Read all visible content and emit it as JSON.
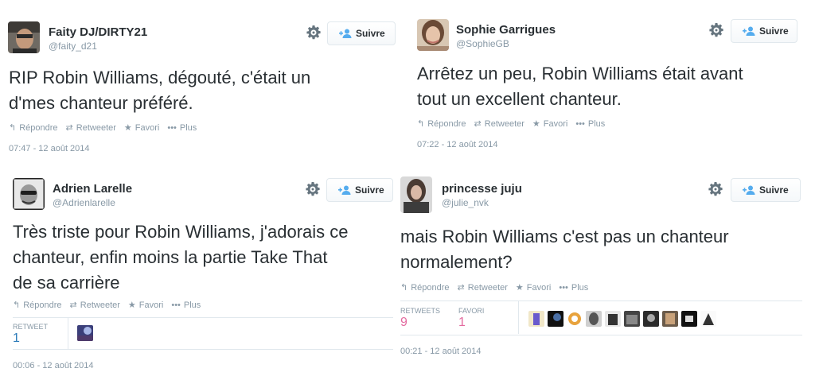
{
  "colors": {
    "text": "#292f33",
    "meta": "#8899a6",
    "follow_icon": "#55acee",
    "retweets_count": "#e36a9f",
    "favorites_count": "#e36a9f",
    "retweet_count_blue": "#2b7bb9",
    "divider": "#e1e8ed"
  },
  "tweets": [
    {
      "name": "Faity DJ/DIRTY21",
      "handle": "@faity_d21",
      "follow_label": "Suivre",
      "text_lines": [
        "RIP Robin Williams, dégouté, c'était un",
        "d'mes chanteur préféré."
      ],
      "actions": {
        "reply": "Répondre",
        "retweet": "Retweeter",
        "favorite": "Favori",
        "more": "Plus"
      },
      "timestamp": "07:47 - 12 août 2014"
    },
    {
      "name": "Sophie Garrigues",
      "handle": "@SophieGB",
      "follow_label": "Suivre",
      "text_lines": [
        "Arrêtez un peu, Robin Williams était avant",
        "tout un excellent chanteur."
      ],
      "actions": {
        "reply": "Répondre",
        "retweet": "Retweeter",
        "favorite": "Favori",
        "more": "Plus"
      },
      "timestamp": "07:22 - 12 août 2014"
    },
    {
      "name": "Adrien Larelle",
      "handle": "@Adrienlarelle",
      "follow_label": "Suivre",
      "text_lines": [
        "Très triste pour Robin Williams, j'adorais ce",
        "chanteur, enfin moins la partie Take That",
        "de sa carrière"
      ],
      "actions": {
        "reply": "Répondre",
        "retweet": "Retweeter",
        "favorite": "Favori",
        "more": "Plus"
      },
      "stats": {
        "retweet_label": "RETWEET",
        "retweet_value": "1"
      },
      "timestamp": "00:06 - 12 août 2014"
    },
    {
      "name": "princesse juju",
      "handle": "@julie_nvk",
      "follow_label": "Suivre",
      "text_lines": [
        "mais Robin Williams c'est pas un chanteur",
        "normalement?"
      ],
      "actions": {
        "reply": "Répondre",
        "retweet": "Retweeter",
        "favorite": "Favori",
        "more": "Plus"
      },
      "stats": {
        "retweets_label": "RETWEETS",
        "retweets_value": "9",
        "favorites_label": "FAVORI",
        "favorites_value": "1"
      },
      "timestamp": "00:21 - 12 août 2014"
    }
  ]
}
